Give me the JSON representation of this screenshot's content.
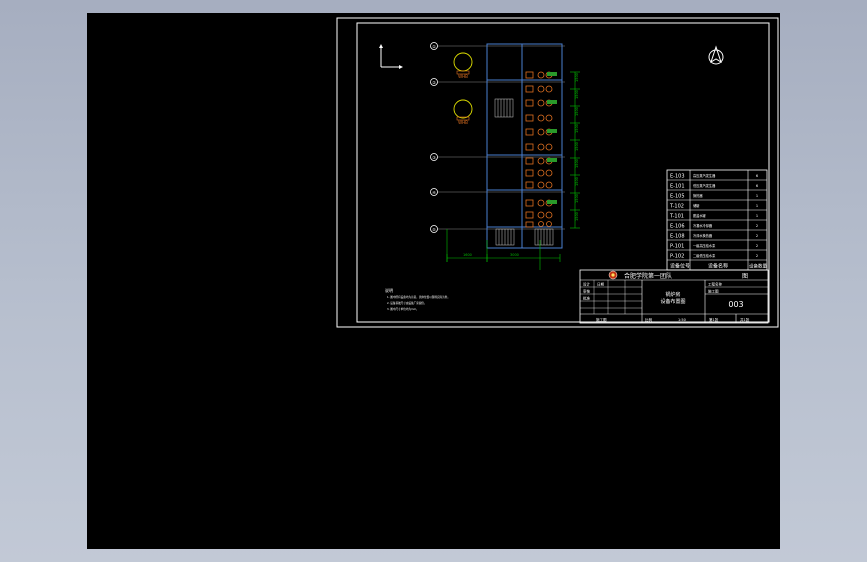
{
  "colors": {
    "viewport_bg": "#000000",
    "frame": "#ffffff",
    "wall": "#4a7fd0",
    "dimension": "#00c000",
    "equipment": "#e07020",
    "axis_line": "#8a8a8a"
  },
  "grid_axes": [
    "①",
    "②",
    "③",
    "④",
    "⑤"
  ],
  "equipment_labels": [
    "WHB",
    "WHB"
  ],
  "notes": {
    "heading": "说明",
    "lines": [
      "1. 图中所有设备均为示意，具体位置以现场实际为准。",
      "2. 设备基础尺寸由设备厂家提供。",
      "3. 图中尺寸单位均为mm。"
    ]
  },
  "equipment_table": {
    "rows": [
      {
        "code": "E-103",
        "name": "高压蒸汽发生器",
        "qty": "6"
      },
      {
        "code": "E-101",
        "name": "低压蒸汽发生器",
        "qty": "6"
      },
      {
        "code": "E-105",
        "name": "换热器",
        "qty": "1"
      },
      {
        "code": "T-102",
        "name": "储罐",
        "qty": "1"
      },
      {
        "code": "T-101",
        "name": "脱盐水罐",
        "qty": "1"
      },
      {
        "code": "E-106",
        "name": "冷凝水冷却器",
        "qty": "2"
      },
      {
        "code": "E-108",
        "name": "冷却水换热器",
        "qty": "2"
      },
      {
        "code": "P-101",
        "name": "一级高压给水泵",
        "qty": "2"
      },
      {
        "code": "P-102",
        "name": "二级低压给水泵",
        "qty": "2"
      }
    ],
    "header": {
      "code": "设备位号",
      "name": "设备名称",
      "qty": "设备数量"
    }
  },
  "title_block": {
    "company": "合肥学院第一团队",
    "drawing_name_1": "锅炉房",
    "drawing_name_2": "设备布置图",
    "drawing_number": "003",
    "scale_label": "比例",
    "scale": "1:50",
    "sheet_label": "第1张",
    "total_label": "共1张",
    "design_label": "设计",
    "check_label": "审核",
    "approve_label": "批准",
    "date_label": "日期",
    "stage": "施工图",
    "project_label": "工程名称",
    "mark": "图"
  },
  "dimensions": {
    "bottom_1": "1600",
    "bottom_2": "3000",
    "right": [
      "1500",
      "1500",
      "1500",
      "1500",
      "1500",
      "1500",
      "1500",
      "1500",
      "1500"
    ]
  }
}
